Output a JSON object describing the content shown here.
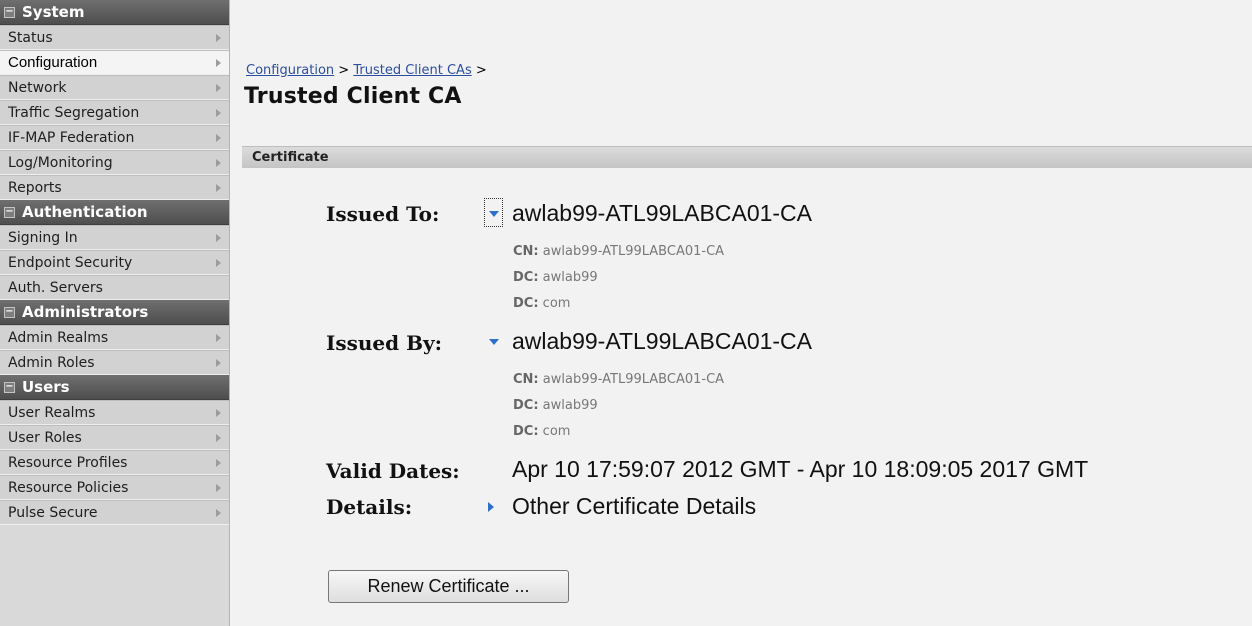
{
  "sidebar": {
    "sections": [
      {
        "title": "System",
        "items": [
          "Status",
          "Configuration",
          "Network",
          "Traffic Segregation",
          "IF-MAP Federation",
          "Log/Monitoring",
          "Reports"
        ]
      },
      {
        "title": "Authentication",
        "items": [
          "Signing In",
          "Endpoint Security",
          "Auth. Servers"
        ]
      },
      {
        "title": "Administrators",
        "items": [
          "Admin Realms",
          "Admin Roles"
        ]
      },
      {
        "title": "Users",
        "items": [
          "User Realms",
          "User Roles",
          "Resource Profiles",
          "Resource Policies",
          "Pulse Secure"
        ]
      }
    ],
    "active_item": "Configuration"
  },
  "breadcrumb": {
    "link1": "Configuration",
    "sep1": " > ",
    "link2": "Trusted Client CAs",
    "sep2": " >"
  },
  "page_title": "Trusted Client CA",
  "section_title": "Certificate",
  "certificate": {
    "issued_to_label": "Issued To:",
    "issued_to_value": "awlab99-ATL99LABCA01-CA",
    "issued_to_details": [
      {
        "key": "CN:",
        "value": "awlab99-ATL99LABCA01-CA"
      },
      {
        "key": "DC:",
        "value": "awlab99"
      },
      {
        "key": "DC:",
        "value": "com"
      }
    ],
    "issued_by_label": "Issued By:",
    "issued_by_value": "awlab99-ATL99LABCA01-CA",
    "issued_by_details": [
      {
        "key": "CN:",
        "value": "awlab99-ATL99LABCA01-CA"
      },
      {
        "key": "DC:",
        "value": "awlab99"
      },
      {
        "key": "DC:",
        "value": "com"
      }
    ],
    "valid_dates_label": "Valid Dates:",
    "valid_dates_value": "Apr 10 17:59:07 2012 GMT - Apr 10 18:09:05 2017 GMT",
    "details_label": "Details:",
    "details_link": "Other Certificate Details"
  },
  "buttons": {
    "renew_label": "Renew Certificate ..."
  },
  "colors": {
    "accent": "#2c70c9",
    "section_header": "#5a5a5a",
    "link": "#2b4ea0"
  }
}
